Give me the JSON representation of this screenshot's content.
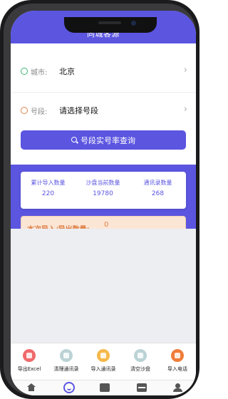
{
  "header": {
    "title": "同城客源"
  },
  "form": {
    "city": {
      "label": "城市:",
      "value": "北京"
    },
    "segment": {
      "label": "号段:",
      "value": "请选择号段"
    }
  },
  "query_button": {
    "label": "号段实号率查询",
    "icon": "search-icon"
  },
  "stats": [
    {
      "label": "累计导入数量",
      "value": "220"
    },
    {
      "label": "沙盘当前数量",
      "value": "19780"
    },
    {
      "label": "通讯录数量",
      "value": "268"
    }
  ],
  "io": {
    "label": "本次导入/导出数量:",
    "value": "0"
  },
  "tools": [
    {
      "label": "导出Excel",
      "color": "#f06a6a"
    },
    {
      "label": "清理通讯录",
      "color": "#bcd3d6"
    },
    {
      "label": "导入通讯录",
      "color": "#f5b84a"
    },
    {
      "label": "清空沙盘",
      "color": "#bcd3d6"
    },
    {
      "label": "导入电话",
      "color": "#ef7d3a"
    }
  ],
  "tabs": [
    {
      "icon": "home-icon"
    },
    {
      "icon": "smile-icon"
    },
    {
      "icon": "box-icon"
    },
    {
      "icon": "archive-icon"
    },
    {
      "icon": "user-icon"
    }
  ],
  "colors": {
    "accent": "#5b55e0",
    "warning_bg": "#fbe6d6",
    "warning_text": "#e0844a"
  }
}
